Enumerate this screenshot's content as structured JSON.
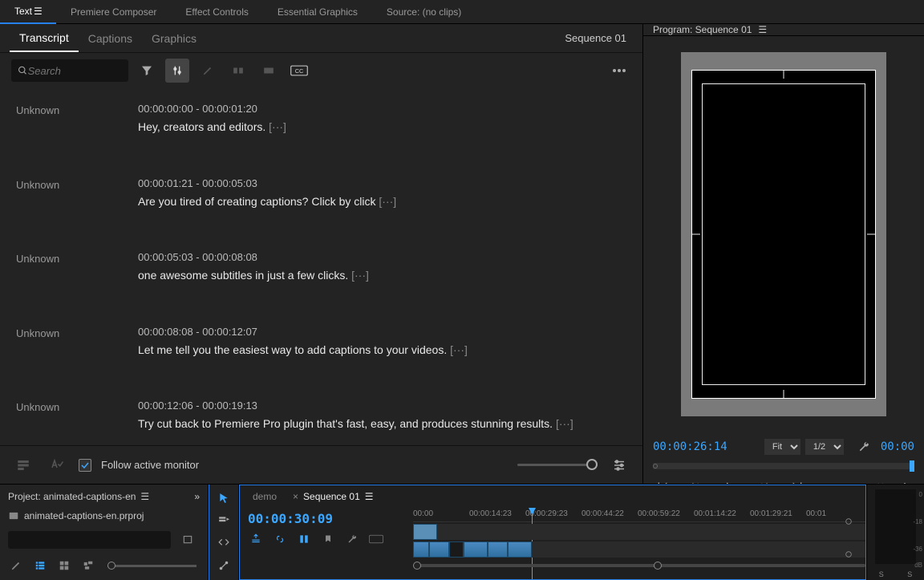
{
  "topTabs": [
    "Text",
    "Premiere Composer",
    "Effect Controls",
    "Essential Graphics",
    "Source: (no clips)"
  ],
  "topTabActive": 0,
  "subTabs": [
    "Transcript",
    "Captions",
    "Graphics"
  ],
  "subTabActive": 0,
  "sequenceName": "Sequence 01",
  "search": {
    "placeholder": "Search"
  },
  "transcript": [
    {
      "speaker": "Unknown",
      "tc": "00:00:00:00 - 00:00:01:20",
      "text": "Hey, creators and editors."
    },
    {
      "speaker": "Unknown",
      "tc": "00:00:01:21 - 00:00:05:03",
      "text": "Are you tired of creating captions? Click by click"
    },
    {
      "speaker": "Unknown",
      "tc": "00:00:05:03 - 00:00:08:08",
      "text": "one awesome subtitles in just a few clicks."
    },
    {
      "speaker": "Unknown",
      "tc": "00:00:08:08 - 00:00:12:07",
      "text": "Let me tell you the easiest way to add captions to your videos."
    },
    {
      "speaker": "Unknown",
      "tc": "00:00:12:06 - 00:00:19:13",
      "text": "Try cut back to Premiere Pro plugin that's fast, easy, and produces stunning results."
    }
  ],
  "followLabel": "Follow active monitor",
  "program": {
    "title": "Program: Sequence 01",
    "timecode": "00:00:26:14",
    "fit": "Fit",
    "res": "1/2",
    "tcRight": "00:00"
  },
  "project": {
    "title": "Project: animated-captions-en",
    "file": "animated-captions-en.prproj"
  },
  "timeline": {
    "tabs": [
      "demo",
      "Sequence 01"
    ],
    "activeTab": 1,
    "timecode": "00:00:30:09",
    "ruler": [
      "00:00",
      "00:00:14:23",
      "00:00:29:23",
      "00:00:44:22",
      "00:00:59:22",
      "00:01:14:22",
      "00:01:29:21",
      "00:01"
    ]
  },
  "meter": {
    "scale": [
      "0",
      "-18",
      "-36",
      "dB"
    ],
    "labels": [
      "S",
      "S"
    ]
  }
}
